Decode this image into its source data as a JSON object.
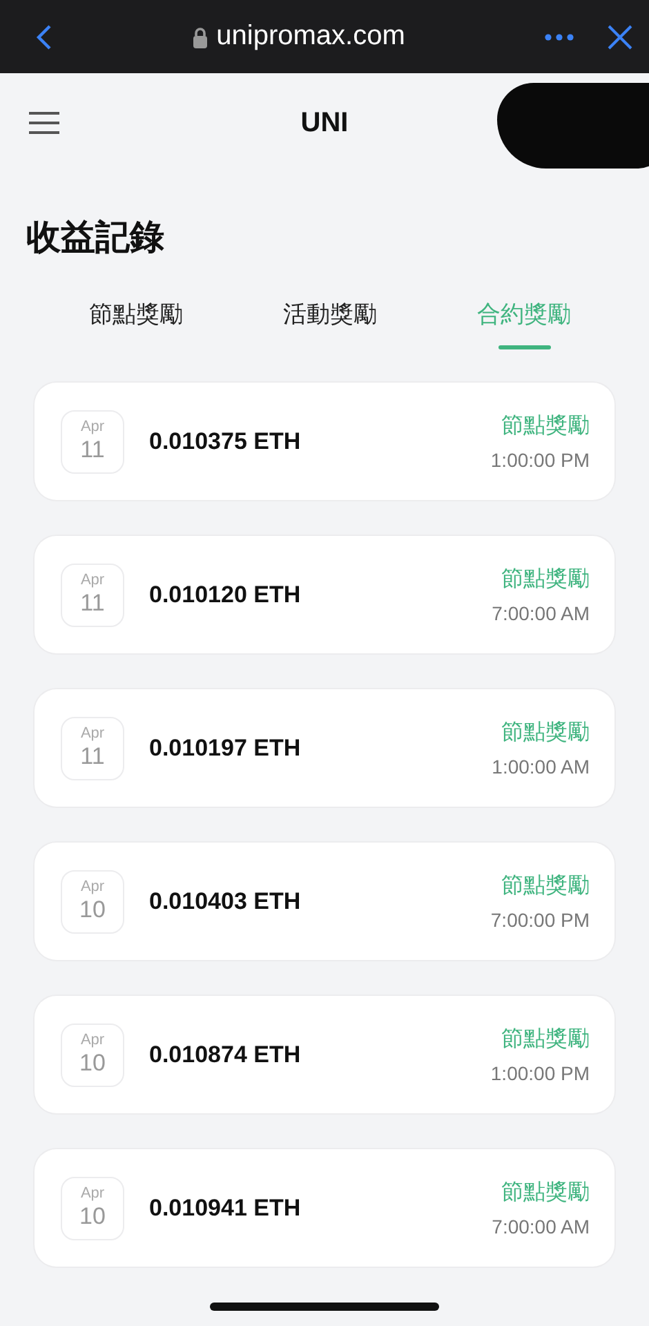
{
  "browser": {
    "url": "unipromax.com"
  },
  "header": {
    "title": "UNI"
  },
  "page_title": "收益記錄",
  "tabs": [
    {
      "label": "節點獎勵",
      "selected": false
    },
    {
      "label": "活動獎勵",
      "selected": false
    },
    {
      "label": "合約獎勵",
      "selected": true
    }
  ],
  "records": [
    {
      "month": "Apr",
      "day": "11",
      "amount": "0.010375 ETH",
      "type": "節點獎勵",
      "time": "1:00:00 PM"
    },
    {
      "month": "Apr",
      "day": "11",
      "amount": "0.010120 ETH",
      "type": "節點獎勵",
      "time": "7:00:00 AM"
    },
    {
      "month": "Apr",
      "day": "11",
      "amount": "0.010197 ETH",
      "type": "節點獎勵",
      "time": "1:00:00 AM"
    },
    {
      "month": "Apr",
      "day": "10",
      "amount": "0.010403 ETH",
      "type": "節點獎勵",
      "time": "7:00:00 PM"
    },
    {
      "month": "Apr",
      "day": "10",
      "amount": "0.010874 ETH",
      "type": "節點獎勵",
      "time": "1:00:00 PM"
    },
    {
      "month": "Apr",
      "day": "10",
      "amount": "0.010941 ETH",
      "type": "節點獎勵",
      "time": "7:00:00 AM"
    }
  ]
}
